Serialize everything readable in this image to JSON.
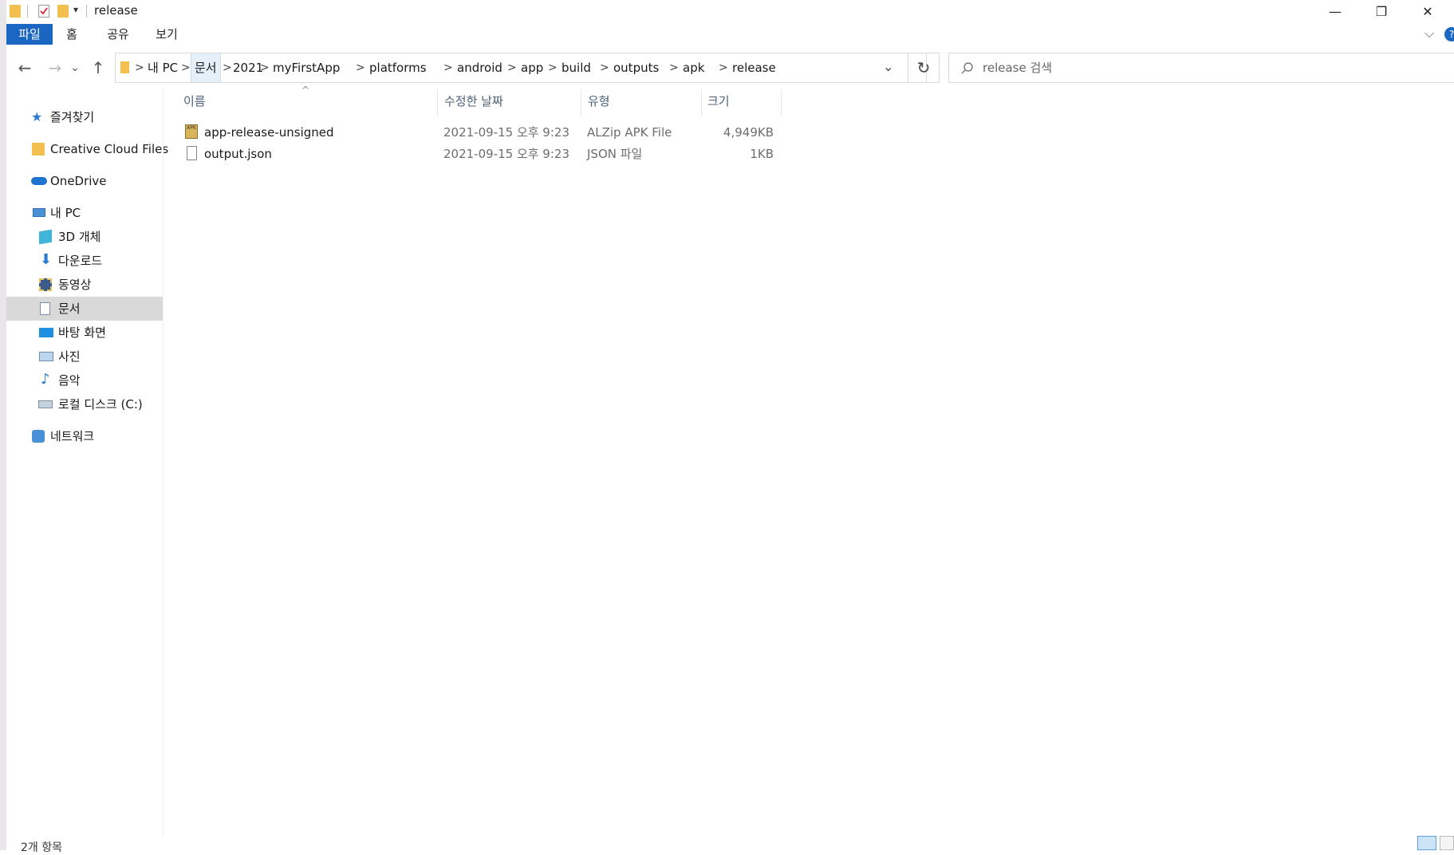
{
  "window": {
    "title": "release",
    "min_glyph": "—",
    "restore_glyph": "❐",
    "close_glyph": "✕",
    "qa_dropdown_glyph": "▾"
  },
  "ribbon": {
    "tabs": [
      "파일",
      "홈",
      "공유",
      "보기"
    ],
    "expand_glyph": "⌵",
    "help_glyph": "?"
  },
  "nav": {
    "back_glyph": "←",
    "forward_glyph": "→",
    "recent_glyph": "⌄",
    "up_glyph": "↑",
    "refresh_glyph": "↻",
    "dropdown_glyph": "⌄",
    "breadcrumb": [
      "내 PC",
      "문서",
      "2021",
      "myFirstApp",
      "platforms",
      "android",
      "app",
      "build",
      "outputs",
      "apk",
      "release"
    ],
    "chevron_glyph": ">"
  },
  "search": {
    "placeholder": "release 검색",
    "icon": "search-icon"
  },
  "sidebar": {
    "items": [
      {
        "label": "즐겨찾기",
        "icon": "star-icon"
      },
      {
        "label": "Creative Cloud Files",
        "icon": "creative-cloud-icon"
      },
      {
        "label": "OneDrive",
        "icon": "cloud-icon"
      },
      {
        "label": "내 PC",
        "icon": "computer-icon"
      },
      {
        "label": "3D 개체",
        "icon": "cube-icon"
      },
      {
        "label": "다운로드",
        "icon": "download-icon"
      },
      {
        "label": "동영상",
        "icon": "video-icon"
      },
      {
        "label": "문서",
        "icon": "document-icon"
      },
      {
        "label": "바탕 화면",
        "icon": "desktop-icon"
      },
      {
        "label": "사진",
        "icon": "picture-icon"
      },
      {
        "label": "음악",
        "icon": "music-icon"
      },
      {
        "label": "로컬 디스크 (C:)",
        "icon": "drive-icon"
      },
      {
        "label": "네트워크",
        "icon": "network-icon"
      }
    ],
    "selected": "문서"
  },
  "filelist": {
    "sort_glyph": "^",
    "columns": {
      "name": "이름",
      "date": "수정한 날짜",
      "type": "유형",
      "size": "크기"
    },
    "rows": [
      {
        "name": "app-release-unsigned",
        "date": "2021-09-15 오후 9:23",
        "type": "ALZip APK File",
        "size": "4,949KB",
        "icon": "apk-file-icon"
      },
      {
        "name": "output.json",
        "date": "2021-09-15 오후 9:23",
        "type": "JSON 파일",
        "size": "1KB",
        "icon": "json-file-icon"
      }
    ]
  },
  "status": {
    "count": "2개 항목"
  },
  "colors": {
    "file_tab": "#1a66c2",
    "selected_bg": "#d9d9d9",
    "header_text": "#4c607a"
  }
}
